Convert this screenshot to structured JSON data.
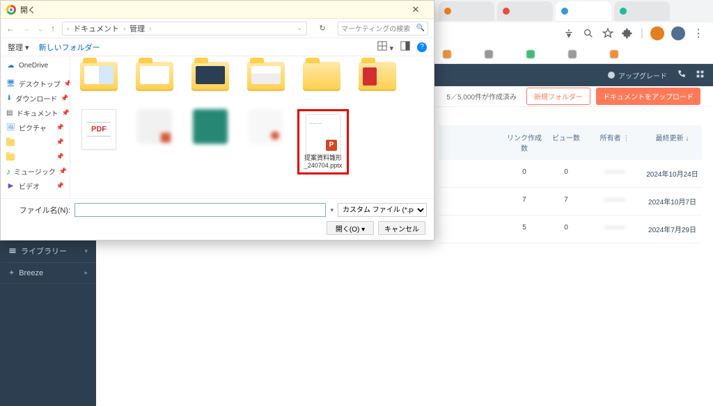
{
  "browser": {
    "tabs": [
      {
        "label": "",
        "color": "#e67e22"
      },
      {
        "label": "",
        "color": "#e74c3c"
      },
      {
        "label": "",
        "color": "#3498db"
      },
      {
        "label": "",
        "color": "#1abc9c"
      }
    ],
    "addrIcons": [
      "translate",
      "search",
      "star",
      "ext"
    ],
    "avatars": [
      "#e67e22",
      "#516f90",
      "#8e44ad"
    ],
    "bookmarks": [
      {
        "label": "",
        "color": "#e67e22"
      },
      {
        "label": "",
        "color": "#888"
      },
      {
        "label": "",
        "color": "#27ae60"
      },
      {
        "label": "",
        "color": "#888"
      },
      {
        "label": "",
        "color": "#e67e22"
      },
      {
        "label": "",
        "color": "#888"
      }
    ]
  },
  "app": {
    "header": {
      "upgrade": "アップグレード"
    },
    "subheader": {
      "quota": "5／5,000件が作成済み",
      "newFolder": "新規フォルダー",
      "upload": "ドキュメントをアップロード"
    },
    "sidebar": {
      "library": "ライブラリー",
      "breeze": "Breeze"
    },
    "table": {
      "headers": {
        "links": "リンク作成数",
        "views": "ビュー数",
        "owner": "所有者",
        "updated": "最終更新"
      },
      "rows": [
        {
          "links": "0",
          "views": "0",
          "owner": "———",
          "updated": "2024年10月24日"
        },
        {
          "links": "7",
          "views": "7",
          "owner": "———",
          "updated": "2024年10月7日"
        },
        {
          "links": "5",
          "views": "0",
          "owner": "———",
          "updated": "2024年7月29日"
        }
      ]
    }
  },
  "dialog": {
    "title": "開く",
    "breadcrumb": {
      "p1": "ドキュメント",
      "p2": "管理",
      "p3": ""
    },
    "search": {
      "placeholder": "マーケティングの検索"
    },
    "toolbar": {
      "organize": "整理",
      "newFolder": "新しいフォルダー"
    },
    "navPane": [
      {
        "label": "OneDrive",
        "type": "cloud"
      },
      {
        "label": "デスクトップ",
        "type": "desktop"
      },
      {
        "label": "ダウンロード",
        "type": "download"
      },
      {
        "label": "ドキュメント",
        "type": "doc"
      },
      {
        "label": "ピクチャ",
        "type": "pic"
      },
      {
        "label": "",
        "type": "folder"
      },
      {
        "label": "",
        "type": "folder"
      },
      {
        "label": "ミュージック",
        "type": "music"
      },
      {
        "label": "ビデオ",
        "type": "video"
      }
    ],
    "files": {
      "row1": [
        {
          "type": "folder",
          "variant": "split"
        },
        {
          "type": "folder",
          "variant": "plain"
        },
        {
          "type": "folder",
          "variant": "dark"
        },
        {
          "type": "folder",
          "variant": "line"
        },
        {
          "type": "folder",
          "variant": "plain"
        },
        {
          "type": "folder",
          "variant": "red"
        },
        {
          "type": "pdf"
        }
      ],
      "row2": [
        {
          "type": "blur"
        },
        {
          "type": "blur-green"
        },
        {
          "type": "blur"
        },
        {
          "type": "pptx",
          "name": "提案資料雛形_240704.pptx"
        },
        {
          "type": "empty"
        },
        {
          "type": "empty"
        },
        {
          "type": "empty"
        }
      ]
    },
    "footer": {
      "fileNameLabel": "ファイル名(N):",
      "fileName": "",
      "filter": "カスタム ファイル (*.pdf;*.ppt;*.ppt",
      "open": "開く(O)",
      "cancel": "キャンセル"
    }
  }
}
